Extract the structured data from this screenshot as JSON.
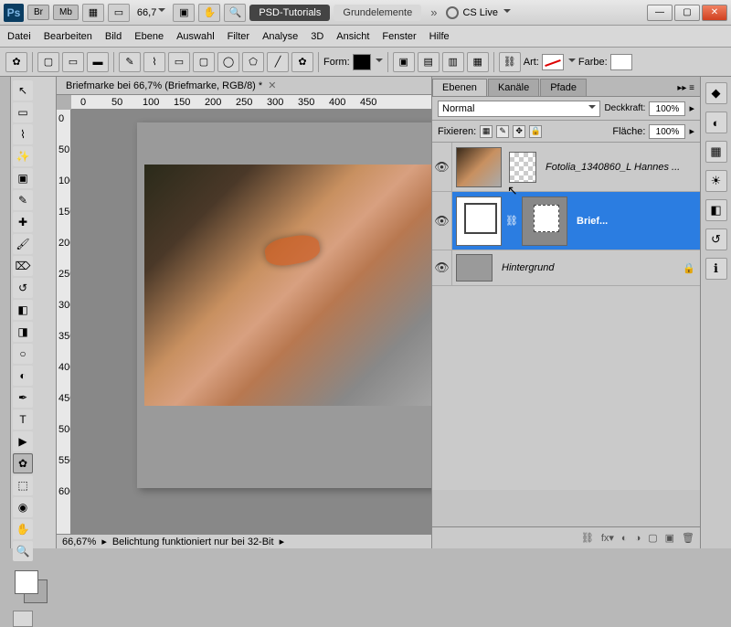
{
  "titlebar": {
    "br": "Br",
    "mb": "Mb",
    "zoom": "66,7",
    "tab1": "PSD-Tutorials",
    "tab2": "Grundelemente",
    "cslive": "CS Live"
  },
  "menu": {
    "datei": "Datei",
    "bearbeiten": "Bearbeiten",
    "bild": "Bild",
    "ebene": "Ebene",
    "auswahl": "Auswahl",
    "filter": "Filter",
    "analyse": "Analyse",
    "dd": "3D",
    "ansicht": "Ansicht",
    "fenster": "Fenster",
    "hilfe": "Hilfe"
  },
  "opt": {
    "form": "Form:",
    "art": "Art:",
    "farbe": "Farbe:"
  },
  "doc": {
    "tab": "Briefmarke bei 66,7% (Briefmarke, RGB/8) *"
  },
  "ruler_h": [
    "0",
    "50",
    "100",
    "150",
    "200",
    "250",
    "300",
    "350",
    "400",
    "450"
  ],
  "ruler_v": [
    "0",
    "50",
    "100",
    "150",
    "200",
    "250",
    "300",
    "350",
    "400",
    "450",
    "500",
    "550",
    "600"
  ],
  "status": {
    "zoom": "66,67%",
    "msg": "Belichtung funktioniert nur bei 32-Bit"
  },
  "panel": {
    "tabs": {
      "ebenen": "Ebenen",
      "kanale": "Kanäle",
      "pfade": "Pfade"
    },
    "blend": "Normal",
    "deck_lbl": "Deckkraft:",
    "deck_val": "100%",
    "fix_lbl": "Fixieren:",
    "flache_lbl": "Fläche:",
    "flache_val": "100%",
    "layers": {
      "l1": "Fotolia_1340860_L Hannes ...",
      "l2": "Brief...",
      "l3": "Hintergrund"
    }
  }
}
